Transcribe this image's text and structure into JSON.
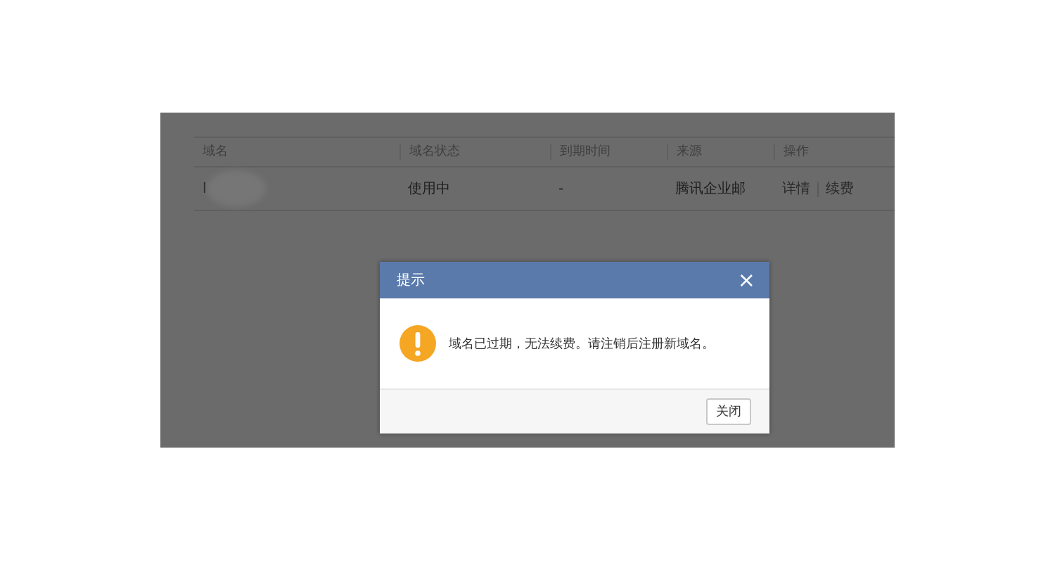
{
  "table": {
    "columns": [
      "域名",
      "域名状态",
      "到期时间",
      "来源",
      "操作"
    ],
    "rows": [
      {
        "domain": "l",
        "status": "使用中",
        "expiry": "-",
        "source": "腾讯企业邮",
        "actions": [
          "详情",
          "续费"
        ]
      }
    ]
  },
  "dialog": {
    "title": "提示",
    "close_icon": "×",
    "message": "域名已过期，无法续费。请注销后注册新域名。",
    "buttons": [
      "关闭"
    ]
  }
}
